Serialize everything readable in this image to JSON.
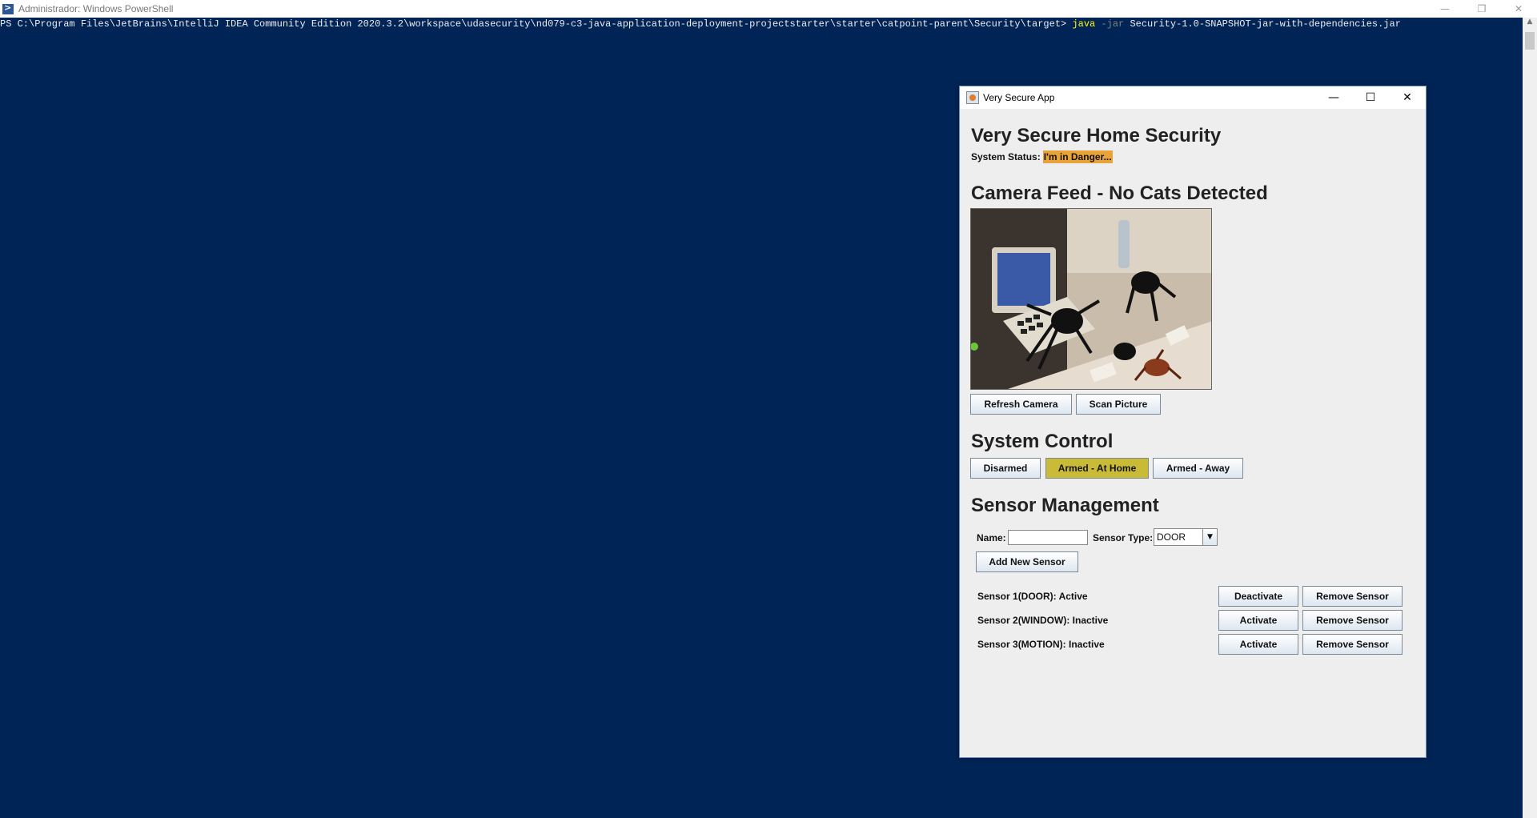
{
  "powershell": {
    "title": "Administrador: Windows PowerShell",
    "prompt": "PS C:\\Program Files\\JetBrains\\IntelliJ IDEA Community Edition 2020.3.2\\workspace\\udasecurity\\nd079-c3-java-application-deployment-projectstarter\\starter\\catpoint-parent\\Security\\target> ",
    "cmd_java": "java",
    "cmd_flag": " -jar ",
    "cmd_arg": "Security-1.0-SNAPSHOT-jar-with-dependencies.jar"
  },
  "app": {
    "window_title": "Very Secure App",
    "heading": "Very Secure Home Security",
    "status_label": "System Status:",
    "status_value": "I'm in Danger...",
    "status_color": "#e8a43b",
    "camera_heading": "Camera Feed - No Cats Detected",
    "refresh_camera": "Refresh Camera",
    "scan_picture": "Scan Picture",
    "control_heading": "System Control",
    "disarmed": "Disarmed",
    "armed_home": "Armed - At Home",
    "armed_away": "Armed - Away",
    "armed_color": "#c9bb35",
    "sensor_heading": "Sensor Management",
    "name_label": "Name:",
    "name_value": "",
    "type_label": "Sensor Type:",
    "type_value": "DOOR",
    "add_sensor": "Add New Sensor",
    "sensors": [
      {
        "label": "Sensor 1(DOOR): Active",
        "toggle": "Deactivate",
        "remove": "Remove Sensor"
      },
      {
        "label": "Sensor 2(WINDOW): Inactive",
        "toggle": "Activate",
        "remove": "Remove Sensor"
      },
      {
        "label": "Sensor 3(MOTION): Inactive",
        "toggle": "Activate",
        "remove": "Remove Sensor"
      }
    ]
  }
}
